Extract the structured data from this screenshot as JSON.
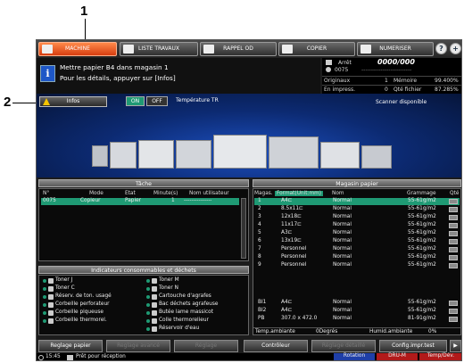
{
  "callouts": [
    "1",
    "2"
  ],
  "tabs": [
    "MACHINE",
    "LISTE TRAVAUX",
    "RAPPEL OD",
    "COPIER",
    "NUMERISER"
  ],
  "top_buttons": [
    "?",
    "+"
  ],
  "message": {
    "line1": "Mettre papier B4 dans magasin 1",
    "line2": "Pour les détails, appuyer sur [Infos]"
  },
  "status": {
    "arret": "Arrêt",
    "counter": "0000/000",
    "counter_sep": "/",
    "job": "0075",
    "dashes": "--------------------------",
    "originaux_label": "Originaux",
    "originaux_value": "1",
    "memoire_label": "Mémoire",
    "memoire_value": "99.400%",
    "impress_label": "En impress.",
    "impress_value": "0",
    "qte_label": "Qté fichier",
    "qte_value": "87.285%"
  },
  "machine_area": {
    "infos_button": "Infos",
    "on_label": "ON",
    "off_label": "OFF",
    "temperature_label": "Température TR",
    "scanner_status": "Scanner disponible"
  },
  "task": {
    "title": "Tâche",
    "headers": [
      "N°",
      "Mode",
      "Etat",
      "Minute(s)",
      "Nom utilisateur"
    ],
    "rows": [
      [
        "0075",
        "Copieur",
        "Papier",
        "1",
        "---------------"
      ]
    ]
  },
  "consumables": {
    "title": "Indicateurs consommables et déchets",
    "left": [
      "Toner J",
      "Toner C",
      "Réserv. de ton. usagé",
      "Corbeille perforateur",
      "Corbeille piqueuse",
      "Corbeille thermorel."
    ],
    "right": [
      "Toner M",
      "Toner N",
      "Cartouche d'agrafes",
      "Bac déchets agrafeuse",
      "Butée lame massicot",
      "Colle thermorelieur",
      "Réservoir d'eau"
    ]
  },
  "paper": {
    "title": "Magasin papier",
    "headers": [
      "Magas.",
      "Format(Unit:mm)",
      "Nom",
      "Grammage",
      "Qté"
    ],
    "rows": [
      [
        "1",
        "A4⊏",
        "Normal",
        "55-61g/m2"
      ],
      [
        "2",
        "8.5x11⊏",
        "Normal",
        "55-61g/m2"
      ],
      [
        "3",
        "12x18⊏",
        "Normal",
        "55-61g/m2"
      ],
      [
        "4",
        "11x17⊏",
        "Normal",
        "55-61g/m2"
      ],
      [
        "5",
        "A3⊏",
        "Normal",
        "55-61g/m2"
      ],
      [
        "6",
        "13x19⊏",
        "Normal",
        "55-61g/m2"
      ],
      [
        "7",
        "Personnel",
        "Normal",
        "55-61g/m2"
      ],
      [
        "8",
        "Personnel",
        "Normal",
        "55-61g/m2"
      ],
      [
        "9",
        "Personnel",
        "Normal",
        "55-61g/m2"
      ]
    ],
    "bypass": [
      [
        "BI1",
        "A4⊏",
        "Normal",
        "55-61g/m2"
      ],
      [
        "BI2",
        "A4⊏",
        "Normal",
        "55-61g/m2"
      ],
      [
        "PB",
        "307.0 x 472.0",
        "Normal",
        "81-91g/m2"
      ]
    ],
    "temp_label": "Temp.ambiante",
    "temp_value": "0Degrés",
    "humid_label": "Humid.ambiante",
    "humid_value": "0%"
  },
  "bottom_buttons": [
    "Reglage papier",
    "Reglage avancé",
    "Réglage",
    "Contrôleur",
    "Réglage détaillé",
    "Config.impr.test"
  ],
  "footer": {
    "time": "15:45",
    "status": "Prêt pour réception",
    "tag1": "Rotation",
    "tag2": "DRU-M",
    "tag3": "Temp/Dév."
  },
  "colors": {
    "accent": "#e8541e",
    "selected_row": "#1f9a74",
    "panel_bg": "#1c1c1c"
  }
}
